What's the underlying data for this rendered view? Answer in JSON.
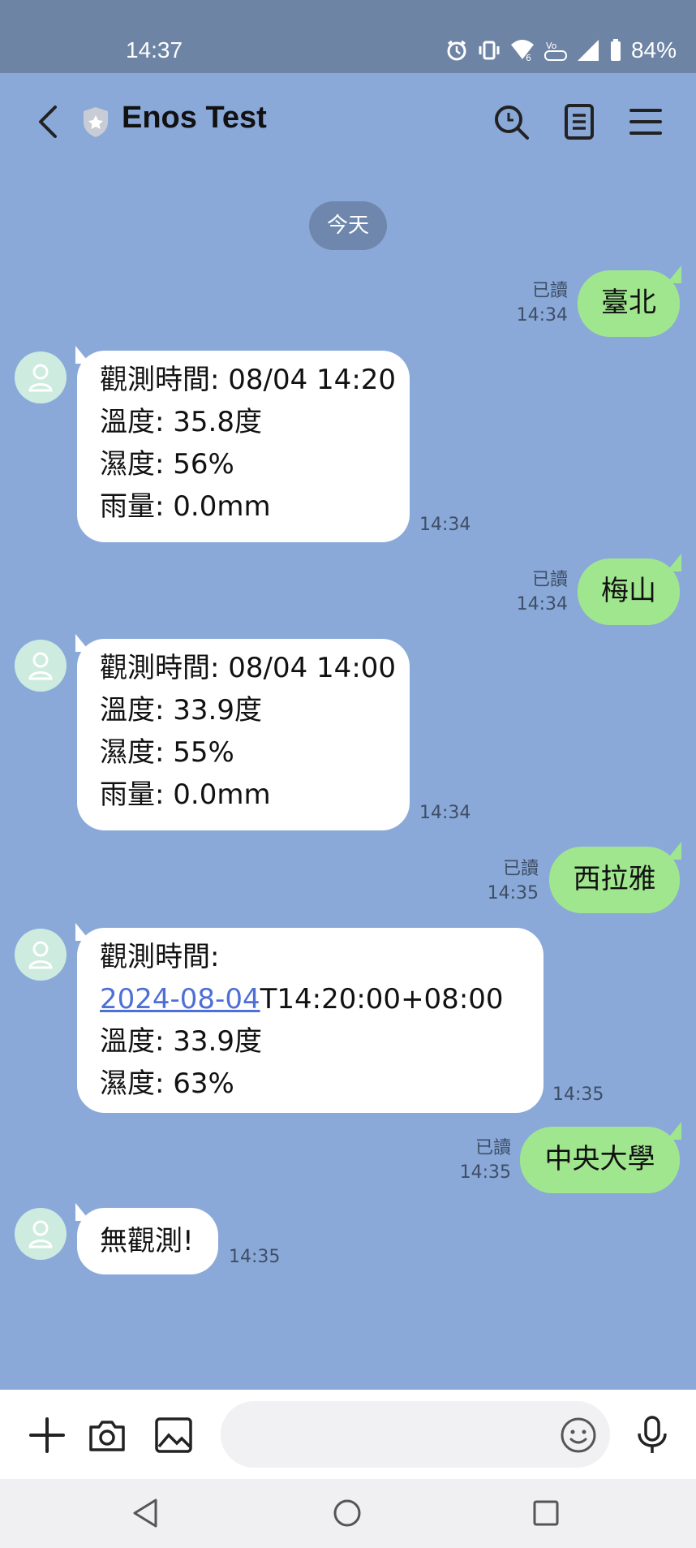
{
  "status_bar": {
    "time": "14:37",
    "battery": "84%"
  },
  "header": {
    "title": "Enos Test"
  },
  "date_separator": "今天",
  "messages": {
    "out1": {
      "text": "臺北",
      "read": "已讀",
      "time": "14:34"
    },
    "in1": {
      "lines": [
        "觀測時間: 08/04 14:20",
        "溫度: 35.8度",
        "濕度: 56%",
        "雨量: 0.0mm"
      ],
      "time": "14:34"
    },
    "out2": {
      "text": "梅山",
      "read": "已讀",
      "time": "14:34"
    },
    "in2": {
      "lines": [
        "觀測時間: 08/04 14:00",
        "溫度: 33.9度",
        "濕度: 55%",
        "雨量: 0.0mm"
      ],
      "time": "14:34"
    },
    "out3": {
      "text": "西拉雅",
      "read": "已讀",
      "time": "14:35"
    },
    "in3": {
      "line1": "觀測時間:",
      "date_link": "2024-08-04",
      "time_suffix": "T14:20:00+08:00",
      "temp": "溫度: 33.9度",
      "humidity": "濕度: 63%",
      "time": "14:35"
    },
    "out4": {
      "text": "中央大學",
      "read": "已讀",
      "time": "14:35"
    },
    "in4": {
      "text": "無觀測!",
      "time": "14:35"
    }
  },
  "input": {
    "value": "",
    "placeholder": ""
  },
  "colors": {
    "chat_bg": "#8AA9D8",
    "out_bubble": "#A0E68E",
    "in_bubble": "#FFFFFF",
    "link": "#4E6FD6"
  }
}
